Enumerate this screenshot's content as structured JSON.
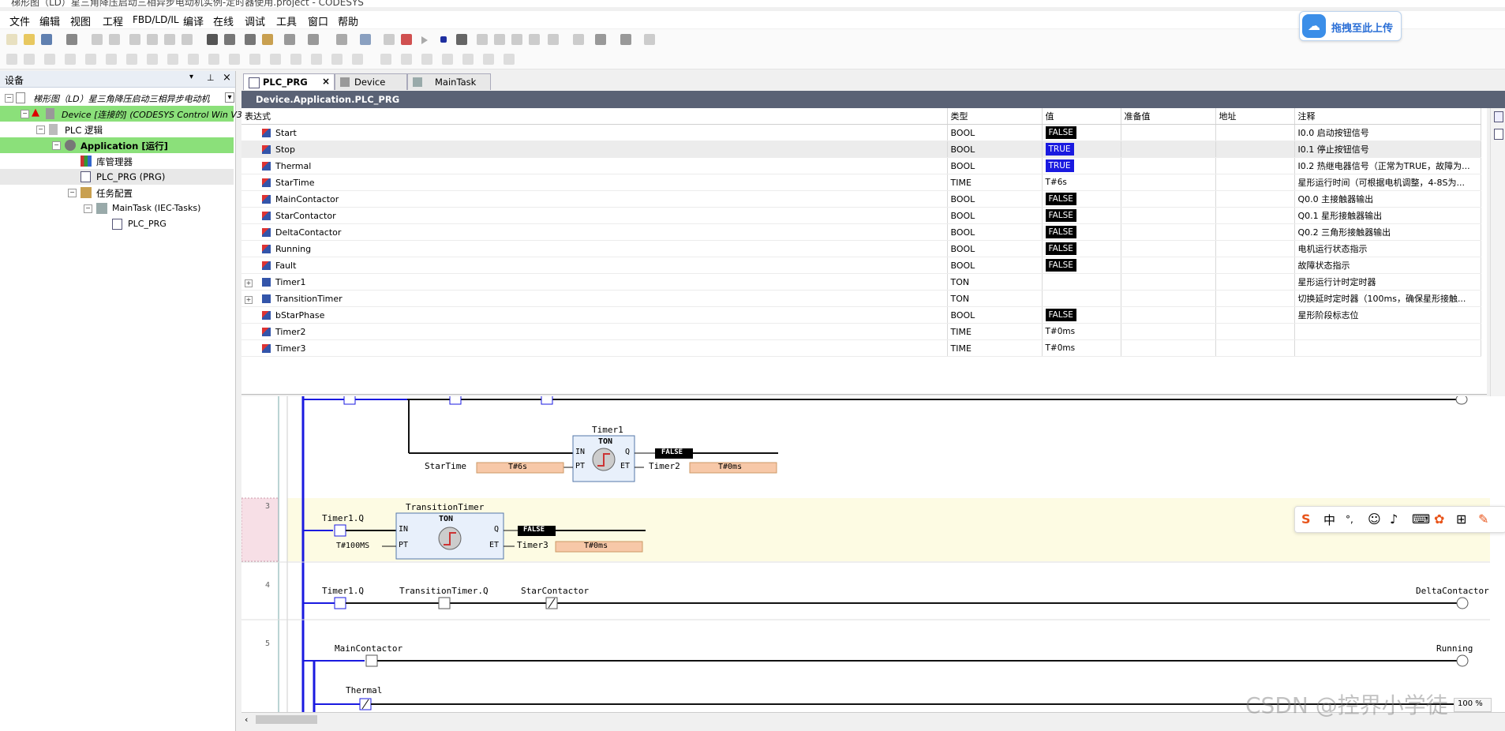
{
  "window": {
    "title": "梯形图（LD）星三角降压启动三相异步电动机实例-定时器使用.project - CODESYS"
  },
  "menu": [
    "文件",
    "编辑",
    "视图",
    "工程",
    "FBD/LD/IL",
    "编译",
    "在线",
    "调试",
    "工具",
    "窗口",
    "帮助"
  ],
  "upload_button": {
    "label": "拖拽至此上传"
  },
  "left_panel": {
    "title": "设备",
    "tree": [
      {
        "label": "梯形图（LD）星三角降压启动三相异步电动机",
        "level": 0
      },
      {
        "label": "Device [连接的] (CODESYS Control Win V3)",
        "level": 1
      },
      {
        "label": "PLC 逻辑",
        "level": 2
      },
      {
        "label": "Application [运行]",
        "level": 3
      },
      {
        "label": "库管理器",
        "level": 4
      },
      {
        "label": "PLC_PRG (PRG)",
        "level": 4
      },
      {
        "label": "任务配置",
        "level": 4
      },
      {
        "label": "MainTask (IEC-Tasks)",
        "level": 5
      },
      {
        "label": "PLC_PRG",
        "level": 6
      }
    ]
  },
  "tabs": [
    {
      "label": "PLC_PRG",
      "active": true
    },
    {
      "label": "Device",
      "active": false
    },
    {
      "label": "MainTask",
      "active": false
    }
  ],
  "path": "Device.Application.PLC_PRG",
  "watch": {
    "headers": [
      "表达式",
      "类型",
      "值",
      "准备值",
      "地址",
      "注释"
    ],
    "rows": [
      {
        "expr": "Start",
        "type": "BOOL",
        "value": "FALSE",
        "kind": "false",
        "comment": "I0.0 启动按钮信号",
        "expandable": false
      },
      {
        "expr": "Stop",
        "type": "BOOL",
        "value": "TRUE",
        "kind": "true",
        "comment": "I0.1 停止按钮信号",
        "expandable": false
      },
      {
        "expr": "Thermal",
        "type": "BOOL",
        "value": "TRUE",
        "kind": "true",
        "comment": "I0.2 热继电器信号（正常为TRUE，故障为...",
        "expandable": false
      },
      {
        "expr": "StarTime",
        "type": "TIME",
        "value": "T#6s",
        "kind": "plain",
        "comment": "星形运行时间（可根据电机调整，4-8S为...",
        "expandable": false
      },
      {
        "expr": "MainContactor",
        "type": "BOOL",
        "value": "FALSE",
        "kind": "false",
        "comment": "Q0.0 主接触器输出",
        "expandable": false
      },
      {
        "expr": "StarContactor",
        "type": "BOOL",
        "value": "FALSE",
        "kind": "false",
        "comment": "Q0.1 星形接触器输出",
        "expandable": false
      },
      {
        "expr": "DeltaContactor",
        "type": "BOOL",
        "value": "FALSE",
        "kind": "false",
        "comment": "Q0.2 三角形接触器输出",
        "expandable": false
      },
      {
        "expr": "Running",
        "type": "BOOL",
        "value": "FALSE",
        "kind": "false",
        "comment": "电机运行状态指示",
        "expandable": false
      },
      {
        "expr": "Fault",
        "type": "BOOL",
        "value": "FALSE",
        "kind": "false",
        "comment": "故障状态指示",
        "expandable": false
      },
      {
        "expr": "Timer1",
        "type": "TON",
        "value": "",
        "kind": "plain",
        "comment": "星形运行计时定时器",
        "expandable": true
      },
      {
        "expr": "TransitionTimer",
        "type": "TON",
        "value": "",
        "kind": "plain",
        "comment": "切换延时定时器（100ms，确保星形接触...",
        "expandable": true
      },
      {
        "expr": "bStarPhase",
        "type": "BOOL",
        "value": "FALSE",
        "kind": "false",
        "comment": "星形阶段标志位",
        "expandable": false
      },
      {
        "expr": "Timer2",
        "type": "TIME",
        "value": "T#0ms",
        "kind": "plain",
        "comment": "",
        "expandable": false
      },
      {
        "expr": "Timer3",
        "type": "TIME",
        "value": "T#0ms",
        "kind": "plain",
        "comment": "",
        "expandable": false
      }
    ]
  },
  "ladder": {
    "rung_numbers": [
      "3",
      "4",
      "5"
    ],
    "timer1": {
      "instance": "Timer1",
      "type": "TON",
      "in": "IN",
      "pt": "PT",
      "q": "Q",
      "et": "ET",
      "pt_var": "StarTime",
      "pt_val": "T#6s",
      "q_val": "FALSE",
      "et_var": "Timer2",
      "et_val": "T#0ms"
    },
    "transition": {
      "instance": "TransitionTimer",
      "type": "TON",
      "in": "IN",
      "pt": "PT",
      "q": "Q",
      "et": "ET",
      "contact": "Timer1.Q",
      "pt_val": "T#100MS",
      "q_val": "FALSE",
      "et_var": "Timer3",
      "et_val": "T#0ms"
    },
    "rung4": {
      "c1": "Timer1.Q",
      "c2": "TransitionTimer.Q",
      "c3": "StarContactor",
      "coil": "DeltaContactor"
    },
    "rung5": {
      "c1": "MainContactor",
      "coil": "Running",
      "c2": "Thermal"
    },
    "zoom": "100 %"
  },
  "ime": {
    "labels": [
      "中",
      "°,"
    ]
  },
  "watermark": "CSDN @控界小学徒"
}
